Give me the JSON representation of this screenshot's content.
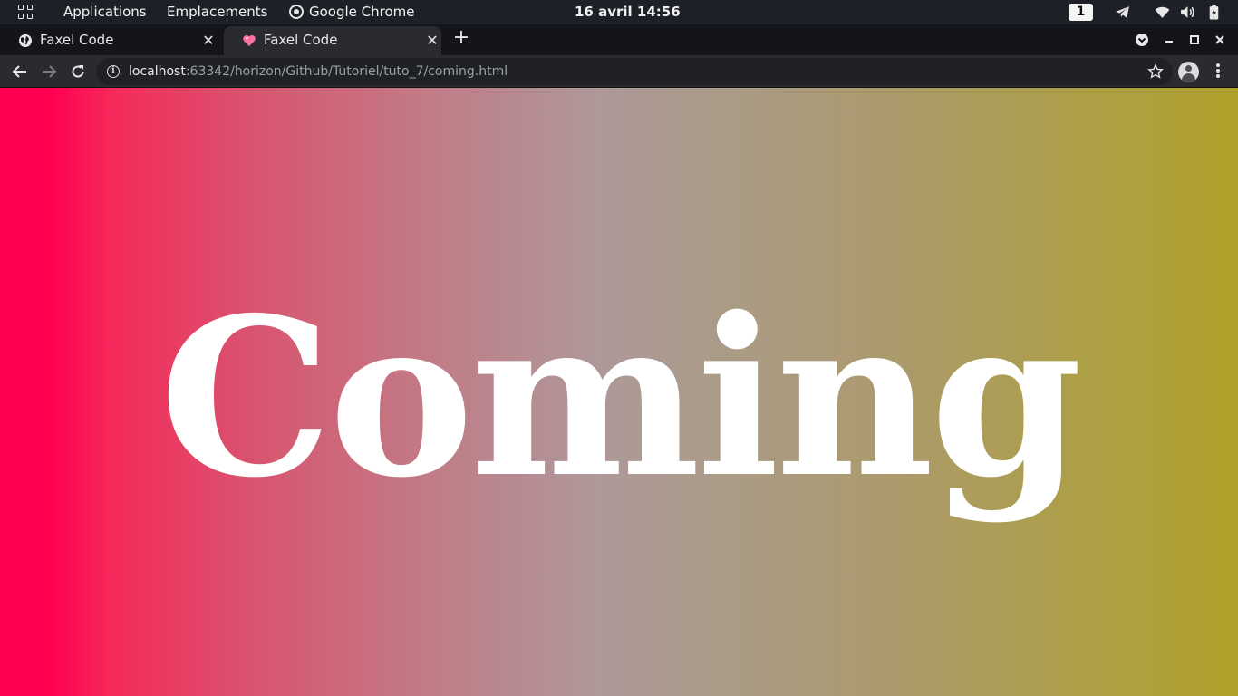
{
  "topbar": {
    "applications_label": "Applications",
    "places_label": "Emplacements",
    "active_app_label": "Google Chrome",
    "clock": "16 avril  14:56",
    "workspace_number": "1"
  },
  "tabs": [
    {
      "title": "Faxel Code",
      "favicon": "globe-icon",
      "active": false
    },
    {
      "title": "Faxel Code",
      "favicon": "heart-icon",
      "active": true
    }
  ],
  "toolbar": {
    "url_host": "localhost",
    "url_rest": ":63342/horizon/Github/Tutoriel/tuto_7/coming.html"
  },
  "page": {
    "headline": "Coming"
  },
  "colors": {
    "gradient_left": "#ff0050",
    "gradient_mid": "#aa9b8c",
    "gradient_right": "#b0a12a",
    "headline": "#ffffff"
  }
}
